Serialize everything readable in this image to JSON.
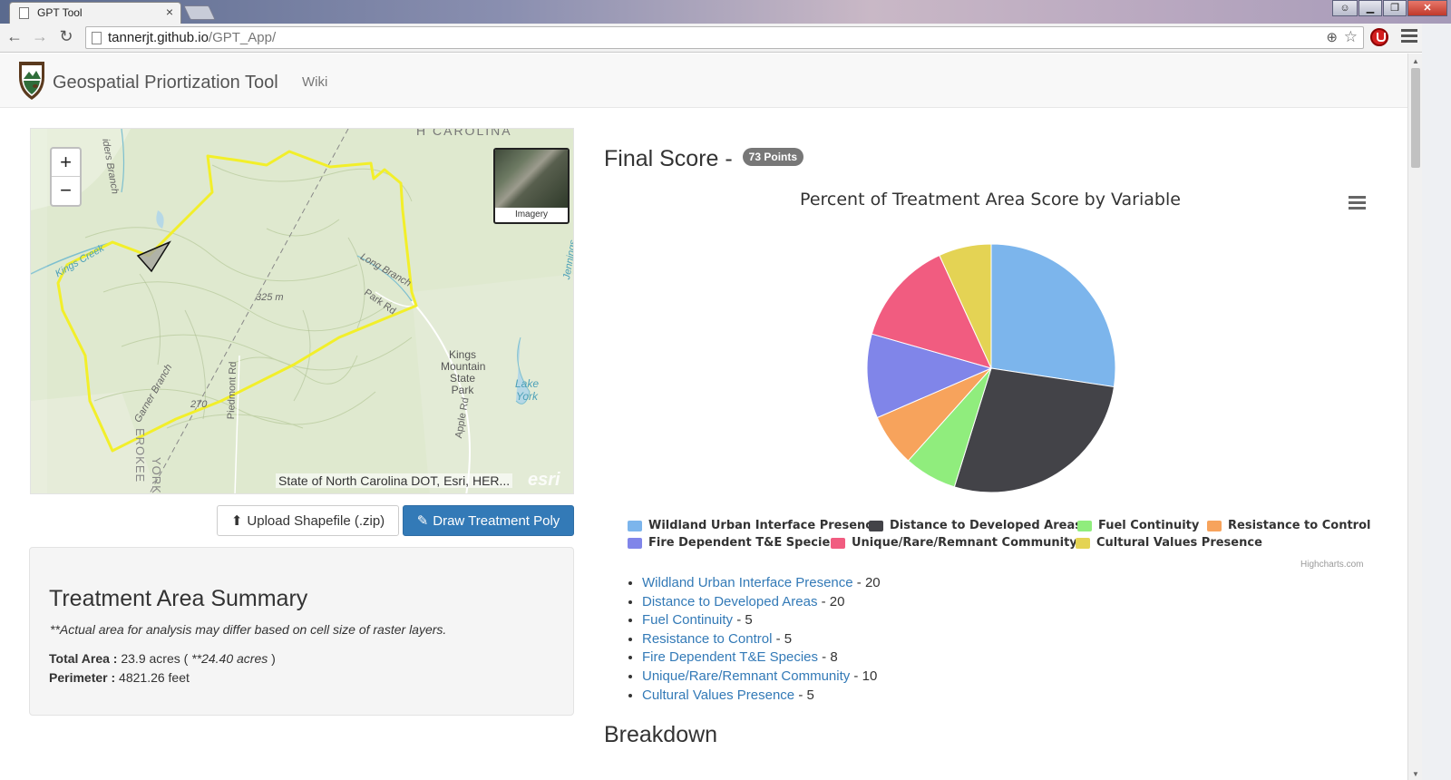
{
  "browser": {
    "tab_title": "GPT Tool",
    "tab_close": "×",
    "url_domain": "tannerjt.github.io",
    "url_path": "/GPT_App/",
    "win_minimize": "▁",
    "win_maximize": "❐",
    "win_close": "✕"
  },
  "navbar": {
    "brand": "Geospatial Priortization Tool",
    "wiki": "Wiki"
  },
  "map": {
    "zoom_in": "+",
    "zoom_out": "−",
    "imagery_label": "Imagery",
    "attribution": "State of North Carolina DOT, Esri, HER...",
    "esri": "esri",
    "labels": {
      "carolina": "H CAROLINA",
      "kings_creek": "Kings Creek",
      "long_branch": "Long Branch",
      "elev_325": "325 m",
      "park_rd": "Park Rd",
      "piedmont_rd": "Piedmont Rd",
      "elev_270": "270",
      "garner_branch": "Garner Branch",
      "apple_rd": "Apple Rd",
      "lake_york_1": "Lake",
      "lake_york_2": "York",
      "park_1": "Kings",
      "park_2": "Mountain",
      "park_3": "State Park",
      "jennings": "Jennings",
      "cherokee": "EROKEE",
      "york": "YORK",
      "branch_top": "iders Branch"
    }
  },
  "buttons": {
    "upload": "Upload Shapefile (.zip)",
    "draw": "Draw Treatment Poly"
  },
  "summary": {
    "title": "Treatment Area Summary",
    "note": "**Actual area for analysis may differ based on cell size of raster layers.",
    "total_area_label": "Total Area :",
    "total_area_value": " 23.9 acres ( ",
    "total_area_actual": "**24.40 acres",
    "total_area_end": " )",
    "perimeter_label": "Perimeter :",
    "perimeter_value": " 4821.26 feet"
  },
  "score": {
    "heading": "Final Score -",
    "badge": "73 Points"
  },
  "chart_data": {
    "type": "pie",
    "title": "Percent of Treatment Area Score by Variable",
    "credits": "Highcharts.com",
    "legend_position": "bottom",
    "series": [
      {
        "name": "Wildland Urban Interface Presence",
        "value": 20,
        "color": "#7cb5ec"
      },
      {
        "name": "Distance to Developed Areas",
        "value": 20,
        "color": "#434348"
      },
      {
        "name": "Fuel Continuity",
        "value": 5,
        "color": "#90ed7d"
      },
      {
        "name": "Resistance to Control",
        "value": 5,
        "color": "#f7a35c"
      },
      {
        "name": "Fire Dependent T&E Species",
        "value": 8,
        "color": "#8085e9"
      },
      {
        "name": "Unique/Rare/Remnant Community",
        "value": 10,
        "color": "#f15c80"
      },
      {
        "name": "Cultural Values Presence",
        "value": 5,
        "color": "#e4d354"
      }
    ]
  },
  "breakdown": {
    "heading": "Breakdown"
  }
}
